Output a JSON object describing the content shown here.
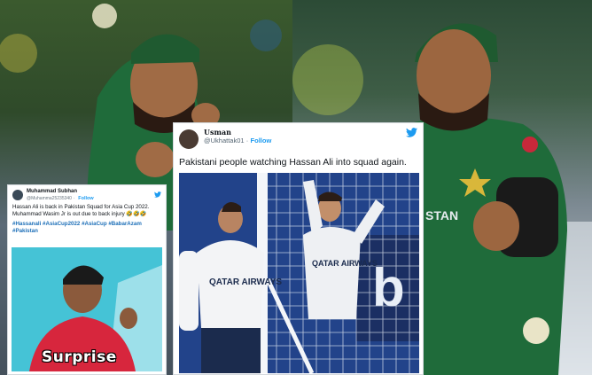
{
  "background": {
    "left_photo": "hassan-ali-catch-left",
    "right_photo": "hassan-ali-catch-right",
    "jersey_text": "STAN"
  },
  "small_tweet": {
    "name": "Muhammad Subhan",
    "handle": "@Muhamma25235340",
    "follow": "Follow",
    "text": "Hassan Ali is back in Pakistan Squad for Asia Cup 2022. Muhammad Wasim Jr is out due to back injury 🤣🤣🤣",
    "hashtags": "#Hassanali #AsiaCup2022 #AsiaCup #BabarAzam #Pakistan",
    "media_caption": "Surprise"
  },
  "main_tweet": {
    "name": "Usman",
    "handle": "@Ukhattak01",
    "separator": "·",
    "follow": "Follow",
    "text": "Pakistani people watching Hassan Ali into squad again.",
    "shirt_left": "QATAR AIRWAYS",
    "shirt_right": "QATAR AIRWAYS"
  },
  "colors": {
    "twitter_blue": "#1d9bf0",
    "hashtag_blue": "#1d6fb8",
    "jersey_green": "#1f6b3a",
    "psg_navy": "#1f3b7a"
  }
}
